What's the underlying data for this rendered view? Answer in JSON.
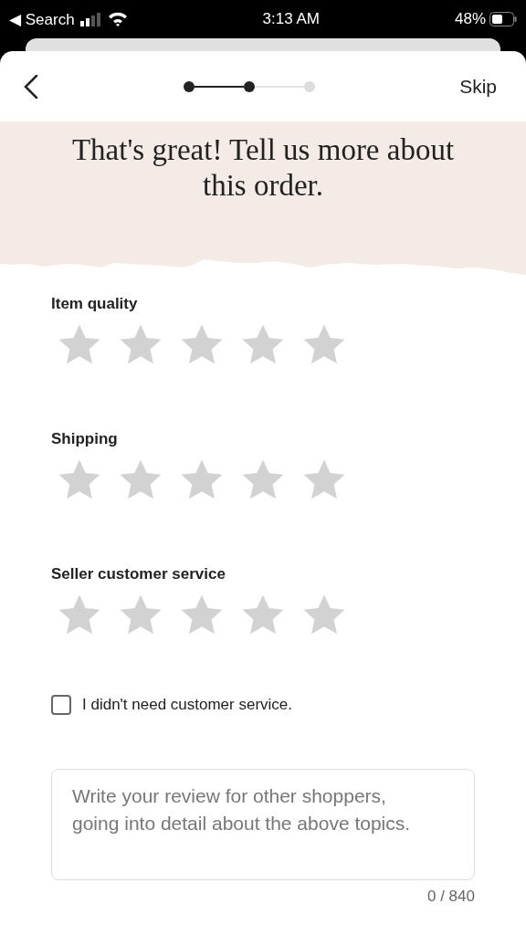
{
  "status_bar": {
    "back_label": "◀ Search",
    "time": "3:13 AM",
    "battery": "48%"
  },
  "header": {
    "skip": "Skip",
    "steps": [
      {
        "done": true
      },
      {
        "done": true
      },
      {
        "done": false
      }
    ]
  },
  "title": "That's great! Tell us more about this order.",
  "ratings": [
    {
      "label": "Item quality",
      "stars": 0
    },
    {
      "label": "Shipping",
      "stars": 0
    },
    {
      "label": "Seller customer service",
      "stars": 0
    }
  ],
  "checkbox": {
    "label": "I didn't need customer service.",
    "checked": false
  },
  "review": {
    "placeholder": "Write your review for other shoppers, going into detail about the above topics.",
    "counter": "0 / 840"
  }
}
